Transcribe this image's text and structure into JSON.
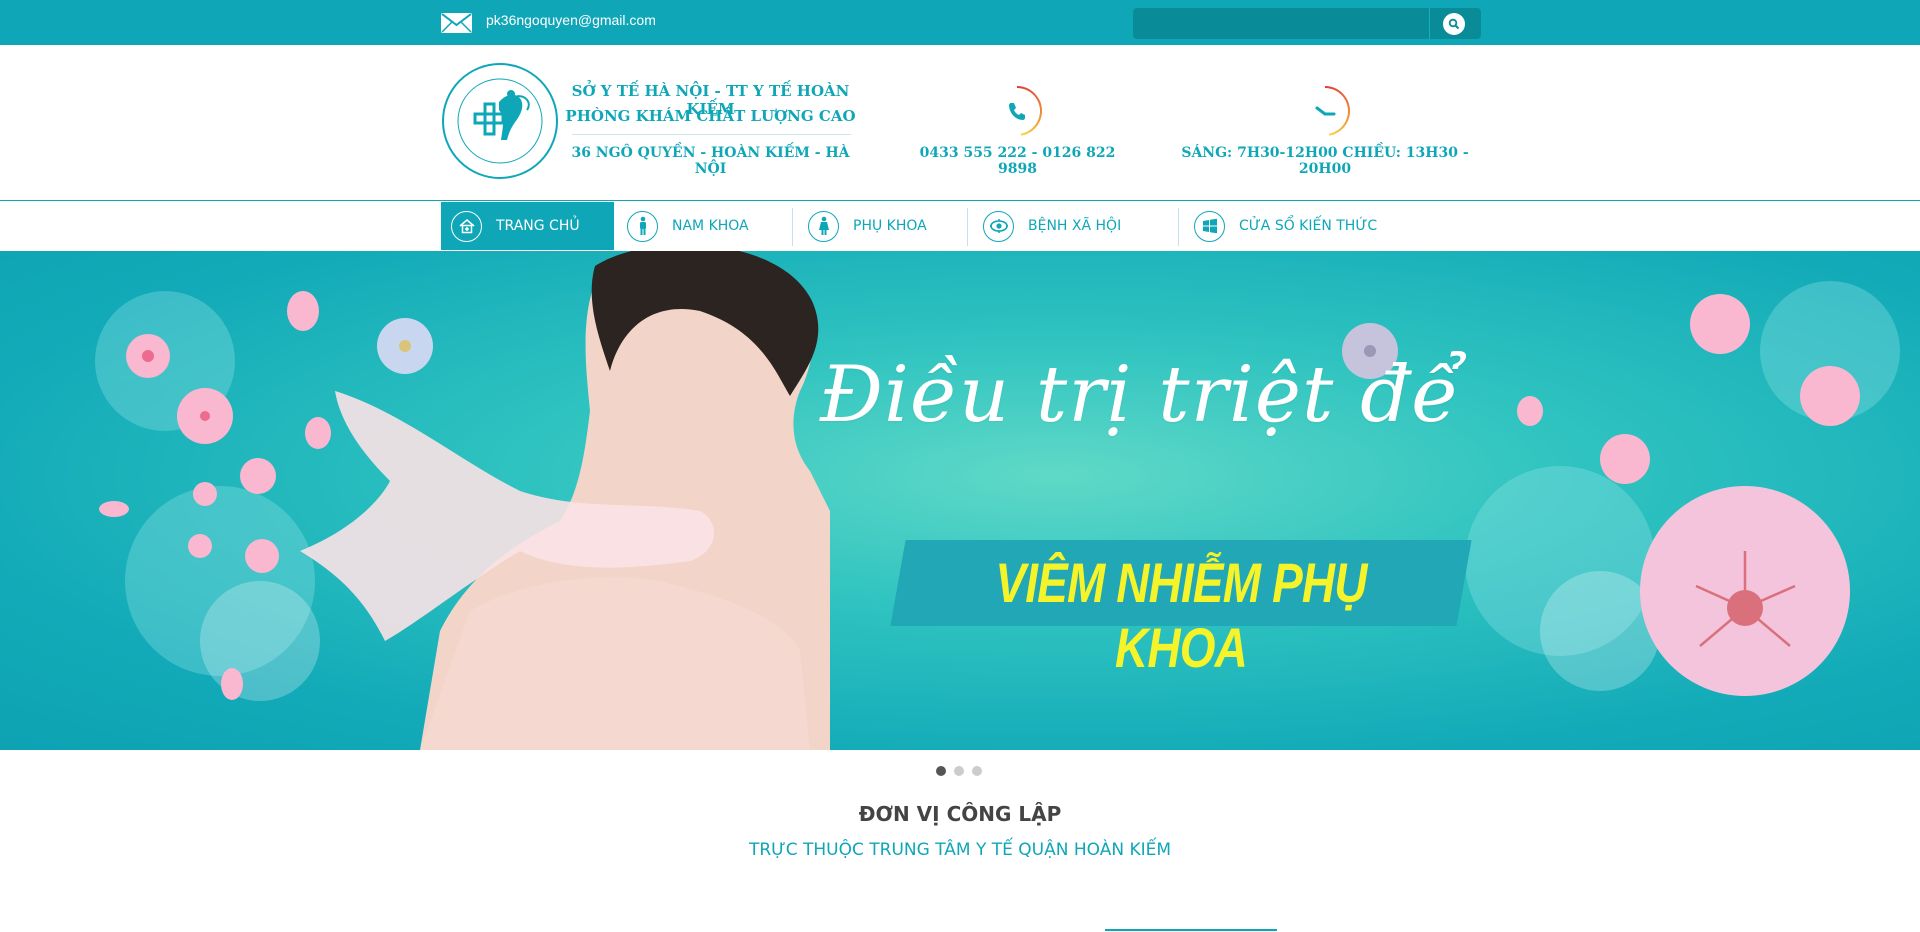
{
  "topbar": {
    "email": "pk36ngoquyen@gmail.com",
    "search_placeholder": ""
  },
  "header": {
    "org_line1": "SỞ Y TẾ HÀ NỘI - TT Y TẾ HOÀN KIẾM",
    "org_line2": "PHÒNG KHÁM CHẤT LƯỢNG CAO",
    "address": "36 NGÔ QUYỀN - HOÀN KIẾM - HÀ NỘI",
    "phones": "0433 555 222 - 0126 822 9898",
    "hours": "SÁNG: 7H30-12H00  CHIỀU: 13H30 - 20H00"
  },
  "nav": {
    "items": [
      {
        "label": "TRANG CHỦ",
        "icon": "home-icon",
        "active": true
      },
      {
        "label": "NAM KHOA",
        "icon": "male-icon"
      },
      {
        "label": "PHỤ KHOA",
        "icon": "female-icon"
      },
      {
        "label": "BỆNH XÃ HỘI",
        "icon": "virus-icon"
      },
      {
        "label": "CỬA SỔ KIẾN THỨC",
        "icon": "windows-icon"
      }
    ]
  },
  "banner": {
    "script_title": "Điều trị triệt để",
    "promo": "VIÊM NHIỄM PHỤ KHOA",
    "slides": 3,
    "active_slide": 1
  },
  "section": {
    "title": "ĐƠN VỊ CÔNG LẬP",
    "subtitle": "TRỰC THUỘC TRUNG TÂM Y TẾ QUẬN HOÀN KIẾM"
  },
  "colors": {
    "primary": "#0fa7b8",
    "promo_yellow": "#f5f32a",
    "blossom_pink": "#f7b8d2"
  }
}
